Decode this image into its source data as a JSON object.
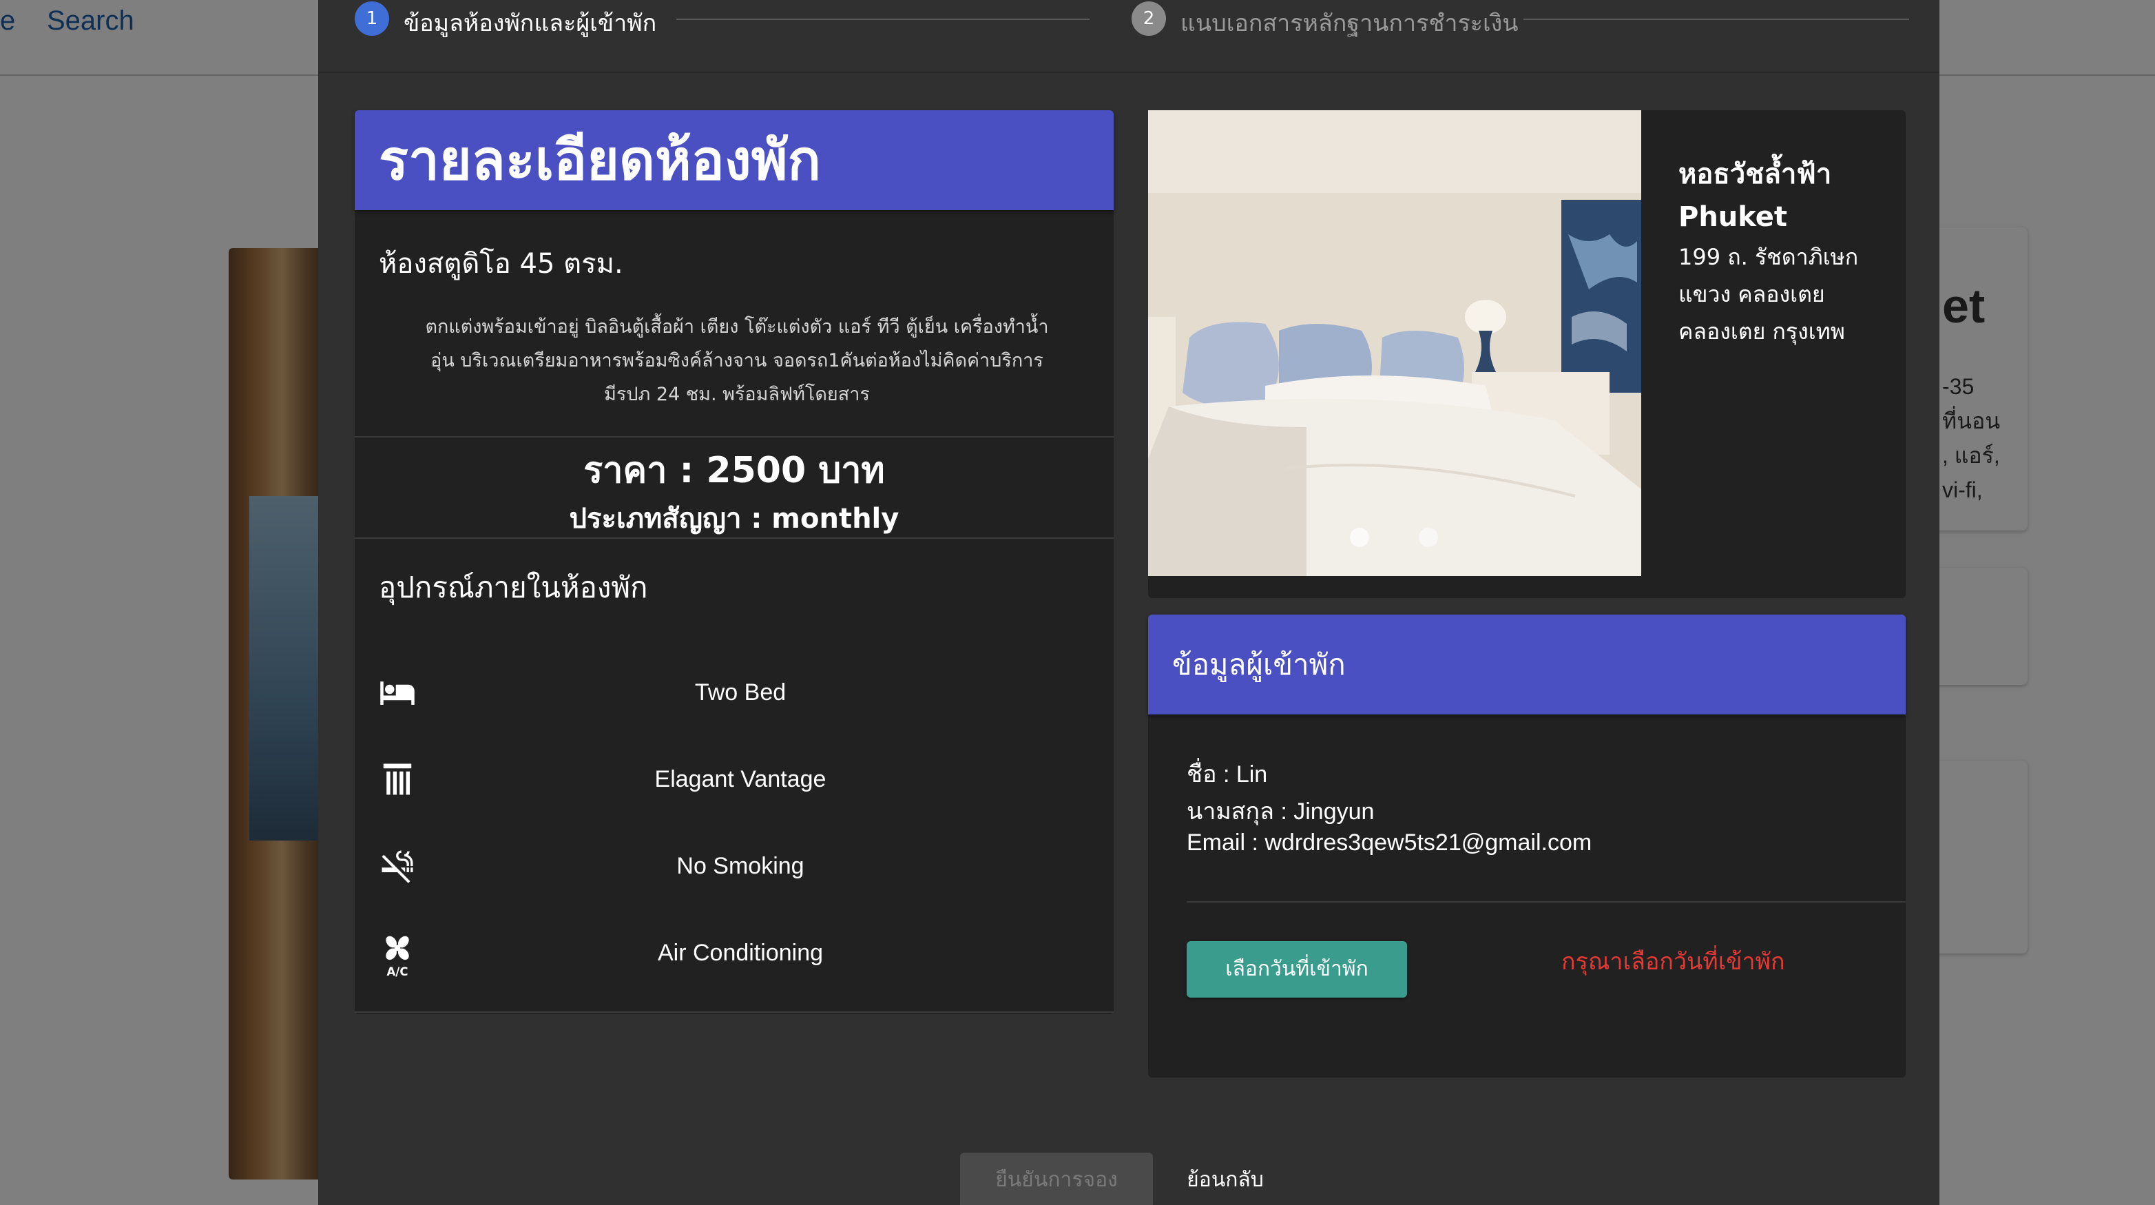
{
  "background": {
    "search_label": "Search",
    "edge_fragment": "e",
    "card_fragment_big": "et",
    "card_fragment_lines": [
      "-35",
      "ที่นอน",
      ", แอร์,",
      "vi-fi,"
    ]
  },
  "stepper": {
    "steps": [
      {
        "number": "1",
        "label": "ข้อมูลห้องพักและผู้เข้าพัก"
      },
      {
        "number": "2",
        "label": "แนบเอกสารหลักฐานการชำระเงิน"
      }
    ]
  },
  "room": {
    "header": "รายละเอียดห้องพัก",
    "name": "ห้องสตูดิโอ 45 ตรม.",
    "description_lines": [
      "ตกแต่งพร้อมเข้าอยู่ บิลอินตู้เสื้อผ้า เตียง โต๊ะแต่งตัว แอร์ ทีวี ตู้เย็น เครื่องทำน้ำ",
      "อุ่น บริเวณเตรียมอาหารพร้อมซิงค์ล้างจาน จอดรถ1คันต่อห้องไม่คิดค่าบริการ",
      "มีรปภ 24 ชม. พร้อมลิฟท์โดยสาร"
    ],
    "price": "ราคา : 2500 บาท",
    "contract_type": "ประเภทสัญญา : monthly",
    "amenities_title": "อุปกรณ์ภายในห้องพัก",
    "amenities": [
      {
        "icon": "bed-icon",
        "label": "Two Bed"
      },
      {
        "icon": "column-icon",
        "label": "Elagant Vantage"
      },
      {
        "icon": "no-smoking-icon",
        "label": "No Smoking"
      },
      {
        "icon": "ac-icon",
        "label": "Air Conditioning"
      }
    ]
  },
  "dorm": {
    "name_line1": "หอธวัชล้ำฟ้า",
    "name_line2": "Phuket",
    "address_lines": [
      "199 ถ. รัชดาภิเษก",
      "แขวง คลองเตย",
      "คลองเตย กรุงเทพ"
    ],
    "carousel_dots": 2
  },
  "guest": {
    "header": "ข้อมูลผู้เข้าพัก",
    "first_name": "ชื่อ : Lin",
    "last_name": "นามสกุล : Jingyun",
    "email": "Email : wdrdres3qew5ts21@gmail.com",
    "select_date_button": "เลือกวันที่เข้าพัก",
    "date_warning": "กรุณาเลือกวันที่เข้าพัก"
  },
  "actions": {
    "confirm": "ยืนยันการจอง",
    "back": "ย้อนกลับ"
  },
  "colors": {
    "accent": "#4a50c2",
    "button_teal": "#3a9c8c",
    "warning": "#e53935",
    "step_active": "#3f6fd6",
    "step_inactive": "#8a8a8a"
  }
}
